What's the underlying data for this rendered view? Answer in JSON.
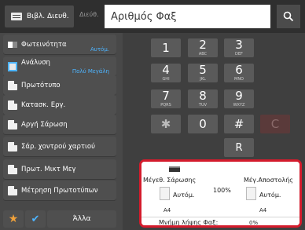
{
  "topbar": {
    "address_book_label": "Βιβλ. Διευθ.",
    "address_label": "Διεύθ.",
    "fax_placeholder": "Αριθμός Φαξ",
    "fax_value": ""
  },
  "left_panel": {
    "items": [
      {
        "label": "Φωτεινότητα",
        "sub": "Αυτόμ.",
        "icon": "brightness-icon"
      },
      {
        "label": "Ανάλυση",
        "sub": "Πολύ Μεγάλη",
        "icon": "resolution-icon"
      },
      {
        "label": "Πρωτότυπο",
        "sub": "",
        "icon": "original-icon"
      },
      {
        "label": "Κατασκ. Εργ.",
        "sub": "",
        "icon": "job-build-icon"
      },
      {
        "label": "Αργή Σάρωση",
        "sub": "",
        "icon": "slow-scan-icon"
      },
      {
        "label": "Σάρ. χοντρού χαρτιού",
        "sub": "",
        "icon": "thick-paper-icon"
      },
      {
        "label": "Πρωτ. Μικτ Μεγ",
        "sub": "",
        "icon": "mixed-size-icon"
      },
      {
        "label": "Μέτρηση Πρωτοτύπων",
        "sub": "",
        "icon": "original-count-icon"
      }
    ],
    "other_label": "Άλλα",
    "fav_icon": "star-icon",
    "check_icon": "check-icon"
  },
  "keypad": {
    "keys": [
      {
        "digit": "1",
        "letters": ""
      },
      {
        "digit": "2",
        "letters": "ABC"
      },
      {
        "digit": "3",
        "letters": "DEF"
      },
      {
        "digit": "4",
        "letters": "GHI"
      },
      {
        "digit": "5",
        "letters": "JKL"
      },
      {
        "digit": "6",
        "letters": "MNO"
      },
      {
        "digit": "7",
        "letters": "PQRS"
      },
      {
        "digit": "8",
        "letters": "TUV"
      },
      {
        "digit": "9",
        "letters": "WXYZ"
      }
    ],
    "star": "✱",
    "zero": "0",
    "hash": "#",
    "clear": "C",
    "redial": "R"
  },
  "status": {
    "scan_size_label": "Μέγεθ. Σάρωσης",
    "send_size_label": "Μέγ.Αποστολής",
    "scan_size_value": "Αυτόμ.",
    "send_size_value": "Αυτόμ.",
    "ratio": "100%",
    "scan_paper": "A4",
    "send_paper": "A4",
    "memory_label": "Μνήμη λήψης Φαξ:",
    "memory_value": "0%"
  },
  "colors": {
    "accent_blue": "#4db4ff",
    "highlight_red": "#d41b2c",
    "star_orange": "#f2a23a"
  }
}
